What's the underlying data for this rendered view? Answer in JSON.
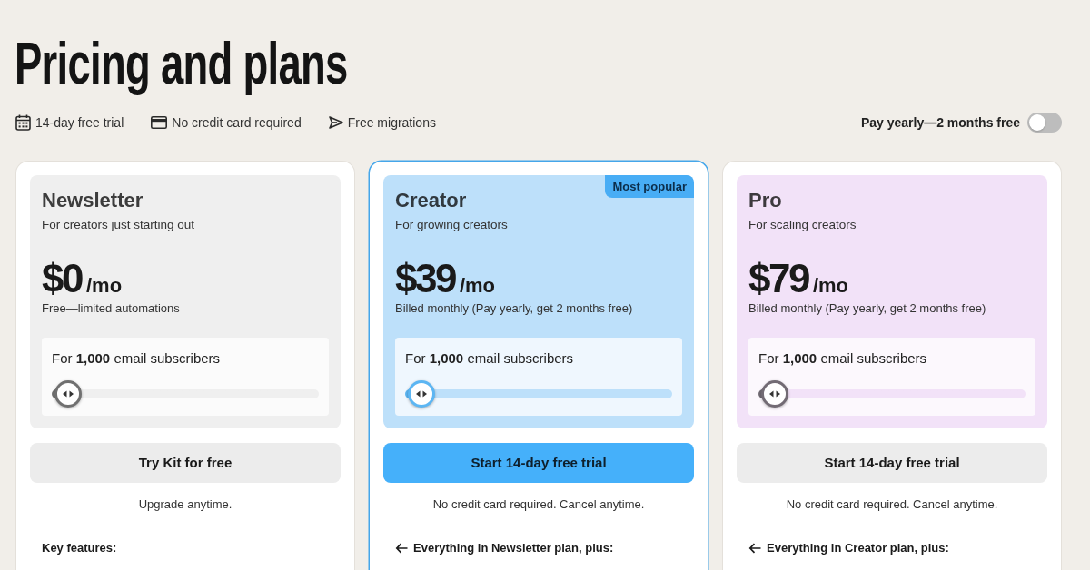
{
  "page": {
    "title": "Pricing and plans"
  },
  "perks": [
    {
      "kind": "trial",
      "text": "14-day free trial"
    },
    {
      "kind": "payment",
      "text": "No credit card required"
    },
    {
      "kind": "migration",
      "text": "Free migrations"
    }
  ],
  "billing_toggle": {
    "label": "Pay yearly—2 months free",
    "on": false
  },
  "plans": [
    {
      "name": "Newsletter",
      "tagline": "For creators just starting out",
      "price": "$0",
      "period": "/mo",
      "billing_note": "Free—limited automations",
      "color": "#efefef",
      "featured": false,
      "subscribers": {
        "label": "For **1,000** email subscribers",
        "level": 0
      },
      "cta": "Try Kit for free",
      "cta_note": "Upgrade anytime.",
      "features_heading": {
        "text": "Key features:",
        "back_arrow": false
      }
    },
    {
      "name": "Creator",
      "badge": "Most popular",
      "tagline": "For growing creators",
      "price": "$39",
      "period": "/mo",
      "billing_note": "Billed monthly (Pay yearly, get 2 months free)",
      "color": "#bde0fa",
      "featured": true,
      "subscribers": {
        "label": "For **1,000** email subscribers",
        "level": 0
      },
      "cta": "Start 14-day free trial",
      "cta_note": "No credit card required. Cancel anytime.",
      "features_heading": {
        "text": "Everything in Newsletter plan, plus:",
        "back_arrow": true
      }
    },
    {
      "name": "Pro",
      "tagline": "For scaling creators",
      "price": "$79",
      "period": "/mo",
      "billing_note": "Billed monthly (Pay yearly, get 2 months free)",
      "color": "#f2e2f8",
      "featured": false,
      "subscribers": {
        "label": "For **1,000** email subscribers",
        "level": 0
      },
      "cta": "Start 14-day free trial",
      "cta_note": "No credit card required. Cancel anytime.",
      "features_heading": {
        "text": "Everything in Creator plan, plus:",
        "back_arrow": true
      }
    }
  ]
}
